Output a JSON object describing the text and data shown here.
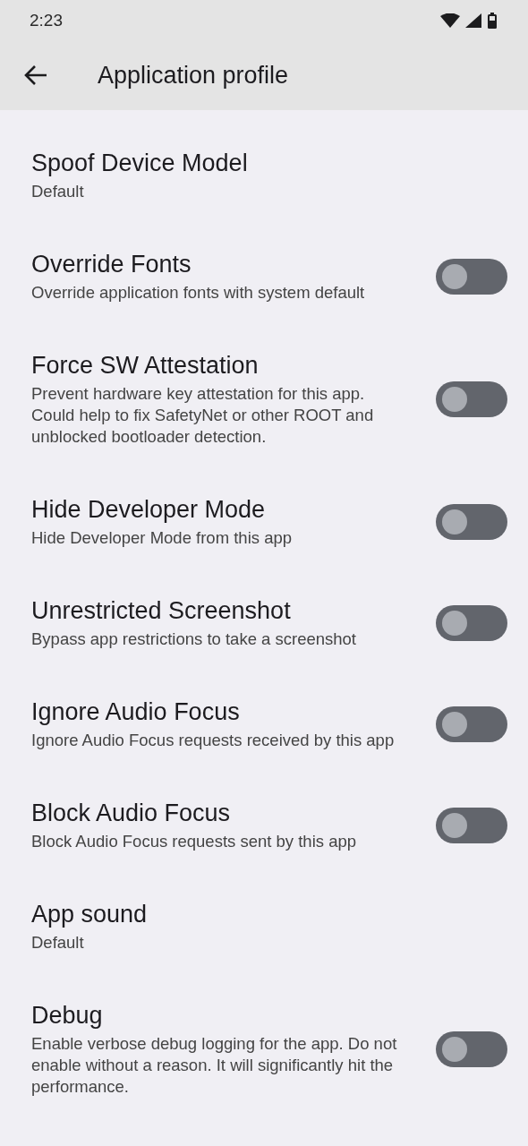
{
  "status_bar": {
    "time": "2:23"
  },
  "app_bar": {
    "title": "Application profile"
  },
  "settings": [
    {
      "kind": "value",
      "title": "Spoof Device Model",
      "summary": "Default"
    },
    {
      "kind": "toggle",
      "title": "Override Fonts",
      "summary": "Override application fonts with system default",
      "on": false
    },
    {
      "kind": "toggle",
      "title": "Force SW Attestation",
      "summary": "Prevent hardware key attestation for this app. Could help to fix SafetyNet or other ROOT and unblocked bootloader detection.",
      "on": false
    },
    {
      "kind": "toggle",
      "title": "Hide Developer Mode",
      "summary": "Hide Developer Mode from this app",
      "on": false
    },
    {
      "kind": "toggle",
      "title": "Unrestricted Screenshot",
      "summary": "Bypass app restrictions to take a screenshot",
      "on": false
    },
    {
      "kind": "toggle",
      "title": "Ignore Audio Focus",
      "summary": "Ignore Audio Focus requests received by this app",
      "on": false
    },
    {
      "kind": "toggle",
      "title": "Block Audio Focus",
      "summary": "Block Audio Focus requests sent by this app",
      "on": false
    },
    {
      "kind": "value",
      "title": "App sound",
      "summary": "Default"
    },
    {
      "kind": "toggle",
      "title": "Debug",
      "summary": "Enable verbose debug logging for the app. Do not enable without a reason. It will significantly hit the performance.",
      "on": false
    }
  ]
}
